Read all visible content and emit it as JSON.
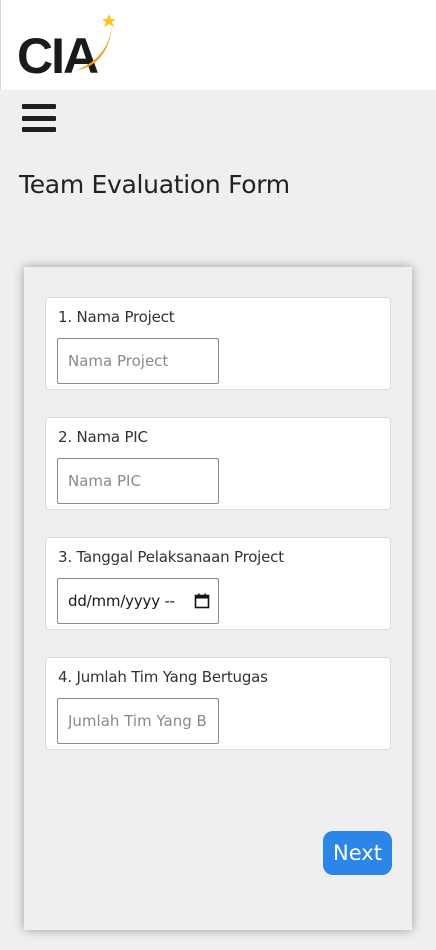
{
  "header": {
    "logo_text": "CIA",
    "logo_colors": {
      "text": "#1a1a1a",
      "swoosh": "#f2a01a",
      "star": "#f5c518"
    },
    "menu_icon": "hamburger-icon"
  },
  "page": {
    "title": "Team Evaluation Form"
  },
  "form": {
    "fields": [
      {
        "label": "1. Nama Project",
        "placeholder": "Nama Project",
        "value": ""
      },
      {
        "label": "2. Nama PIC",
        "placeholder": "Nama PIC",
        "value": ""
      },
      {
        "label": "3. Tanggal Pelaksanaan Project",
        "value": "dd/mm/yyyy --",
        "icon": "calendar-icon"
      },
      {
        "label": "4. Jumlah Tim Yang Bertugas",
        "placeholder": "Jumlah Tim Yang B",
        "value": ""
      }
    ],
    "next_label": "Next"
  },
  "colors": {
    "accent": "#2b86e8",
    "background": "#efefef"
  }
}
